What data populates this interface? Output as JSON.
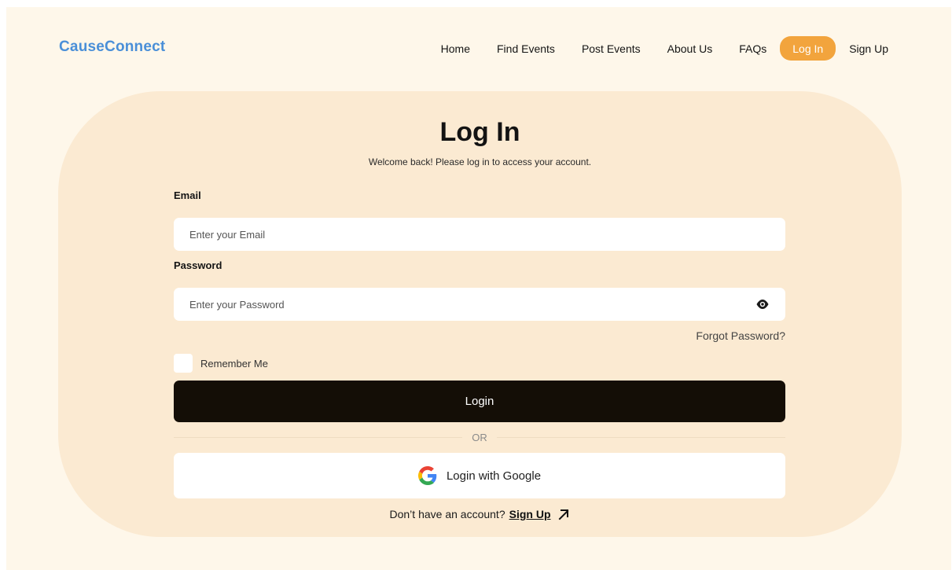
{
  "header": {
    "logo": "CauseConnect",
    "nav": [
      {
        "label": "Home"
      },
      {
        "label": "Find Events"
      },
      {
        "label": "Post Events"
      },
      {
        "label": "About Us"
      },
      {
        "label": "FAQs"
      }
    ],
    "login_label": "Log In",
    "signup_label": "Sign Up"
  },
  "card": {
    "title": "Log In",
    "subtitle": "Welcome back! Please log in to access your account.",
    "email": {
      "label": "Email",
      "placeholder": "Enter your Email",
      "value": ""
    },
    "password": {
      "label": "Password",
      "placeholder": "Enter your Password",
      "value": "",
      "icon": "eye-icon"
    },
    "forgot_label": "Forgot Password?",
    "remember_label": "Remember Me",
    "remember_checked": false,
    "login_button": "Login",
    "or_text": "OR",
    "google_button": "Login with Google",
    "signup_prompt": "Don’t have an account?",
    "signup_link": "Sign Up"
  },
  "colors": {
    "page_bg": "#fef7ea",
    "card_bg": "#fbead2",
    "logo": "#4a8fd8",
    "accent": "#f2a43d",
    "primary_button": "#140e06"
  }
}
